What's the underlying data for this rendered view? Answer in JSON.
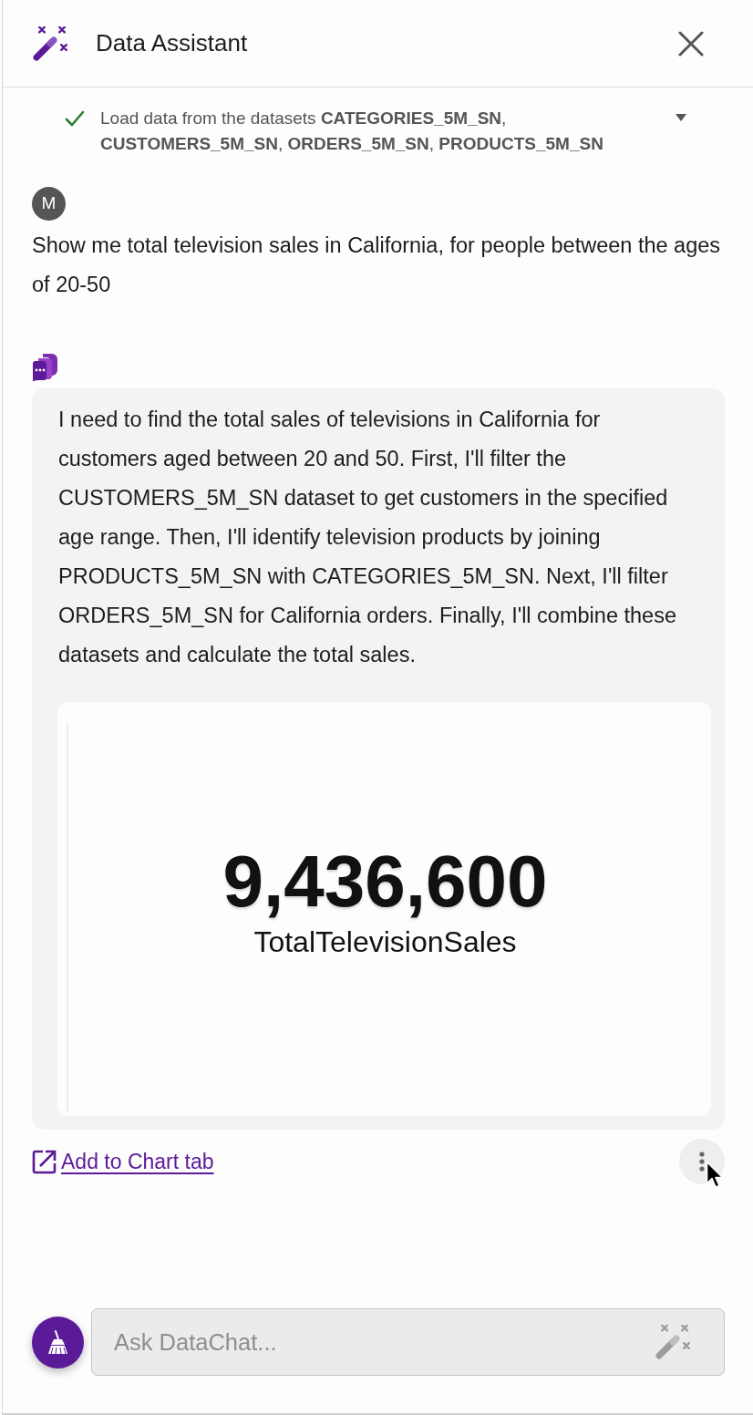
{
  "header": {
    "title": "Data Assistant"
  },
  "steps": [
    {
      "completed": true,
      "text": "Load data from the datasets **CATEGORIES_5M_SN**, **CUSTOMERS_5M_SN**, **ORDERS_5M_SN**, **PRODUCTS_5M_SN**",
      "expanded": false
    }
  ],
  "messages": [
    {
      "kind": "user",
      "avatar": "M",
      "text": "Show me total television sales in California, for people between the ages of 20-50"
    },
    {
      "kind": "assistant",
      "text": "I need to find the total sales of televisions in California for customers aged between 20 and 50. First, I'll filter the CUSTOMERS_5M_SN dataset to get customers in the specified age range. Then, I'll identify television products by joining PRODUCTS_5M_SN with CATEGORIES_5M_SN. Next, I'll filter ORDERS_5M_SN for California orders. Finally, I'll combine these datasets and calculate the total sales.",
      "result": {
        "value": "9,436,600",
        "label": "TotalTelevisionSales"
      },
      "link": "Add to Chart tab"
    }
  ],
  "composer": {
    "placeholder": "Ask DataChat..."
  }
}
